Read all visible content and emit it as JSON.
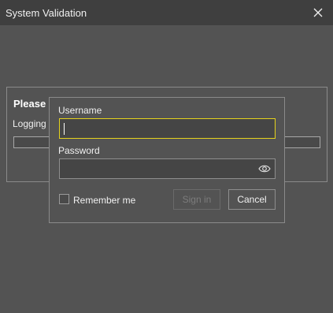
{
  "window": {
    "title": "System Validation"
  },
  "background_panel": {
    "title": "Please",
    "message": "Logging"
  },
  "login": {
    "username_label": "Username",
    "username_value": "",
    "password_label": "Password",
    "password_value": "",
    "remember_label": "Remember me",
    "remember_checked": false,
    "sign_in_label": "Sign in",
    "cancel_label": "Cancel"
  },
  "colors": {
    "focus_border": "#e5d21d",
    "background": "#535353",
    "titlebar": "#3f3f3f"
  },
  "icons": {
    "close": "close-icon",
    "show_password": "eye-icon"
  }
}
